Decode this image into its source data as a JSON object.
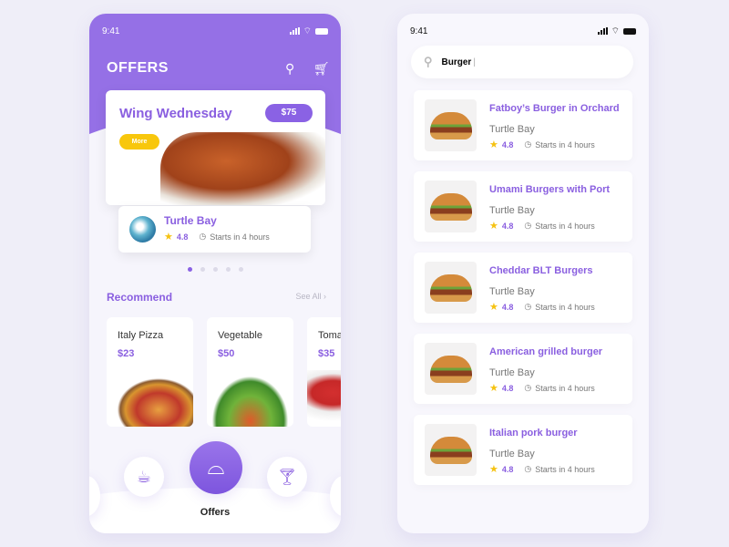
{
  "left": {
    "status_time": "9:41",
    "title": "OFFERS",
    "offer": {
      "title": "Wing Wednesday",
      "price": "$75",
      "more_label": "More",
      "restaurant": "Turtle Bay",
      "rating": "4.8",
      "time": "Starts in 4 hours"
    },
    "carousel": {
      "pages": 5,
      "active": 1
    },
    "recommend": {
      "title": "Recommend",
      "see_all": "See All",
      "items": [
        {
          "name": "Italy Pizza",
          "price": "$23"
        },
        {
          "name": "Vegetable",
          "price": "$50"
        },
        {
          "name": "Toma",
          "price": "$35"
        }
      ]
    },
    "nav": {
      "active_label": "Offers",
      "icons": [
        "coffee-icon",
        "cloche-icon",
        "cocktail-icon"
      ]
    }
  },
  "right": {
    "status_time": "9:41",
    "search_value": "Burger",
    "results": [
      {
        "title": "Fatboy’s Burger in Orchard",
        "restaurant": "Turtle Bay",
        "rating": "4.8",
        "time": "Starts in 4 hours"
      },
      {
        "title": "Umami Burgers with Port",
        "restaurant": "Turtle Bay",
        "rating": "4.8",
        "time": "Starts in 4 hours"
      },
      {
        "title": "Cheddar BLT Burgers",
        "restaurant": "Turtle Bay",
        "rating": "4.8",
        "time": "Starts in 4 hours"
      },
      {
        "title": "American grilled burger",
        "restaurant": "Turtle Bay",
        "rating": "4.8",
        "time": "Starts in 4 hours"
      },
      {
        "title": "Italian pork burger",
        "restaurant": "Turtle Bay",
        "rating": "4.8",
        "time": "Starts in 4 hours"
      }
    ]
  },
  "colors": {
    "primary": "#9570e6",
    "accent": "#f8c70c",
    "star": "#f5c211"
  }
}
